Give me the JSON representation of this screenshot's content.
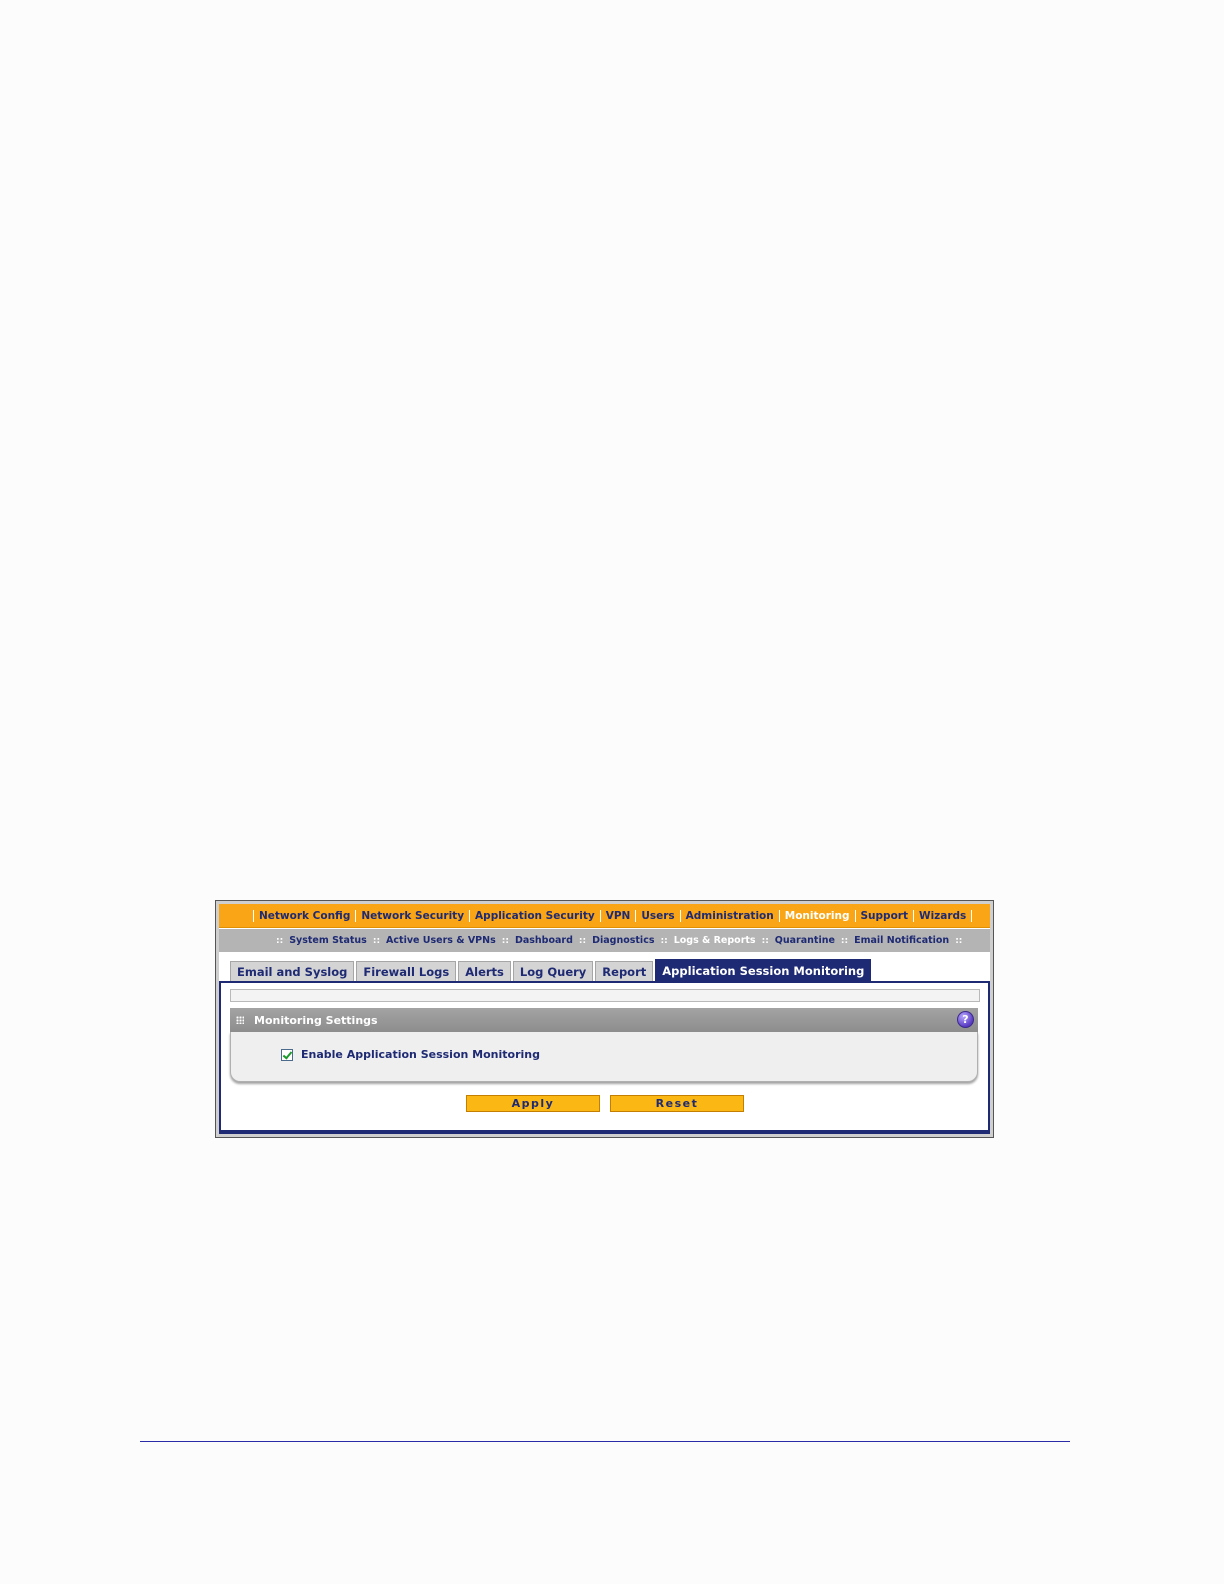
{
  "main_nav": {
    "items": [
      {
        "label": "Network Config",
        "active": false
      },
      {
        "label": "Network Security",
        "active": false
      },
      {
        "label": "Application Security",
        "active": false
      },
      {
        "label": "VPN",
        "active": false
      },
      {
        "label": "Users",
        "active": false
      },
      {
        "label": "Administration",
        "active": false
      },
      {
        "label": "Monitoring",
        "active": true
      },
      {
        "label": "Support",
        "active": false
      },
      {
        "label": "Wizards",
        "active": false
      }
    ]
  },
  "sub_nav": {
    "items": [
      {
        "label": "System Status",
        "active": false
      },
      {
        "label": "Active Users & VPNs",
        "active": false
      },
      {
        "label": "Dashboard",
        "active": false
      },
      {
        "label": "Diagnostics",
        "active": false
      },
      {
        "label": "Logs & Reports",
        "active": true
      },
      {
        "label": "Quarantine",
        "active": false
      },
      {
        "label": "Email Notification",
        "active": false
      }
    ],
    "separator": "::"
  },
  "tabs": [
    {
      "label": "Email and Syslog",
      "active": false
    },
    {
      "label": "Firewall Logs",
      "active": false
    },
    {
      "label": "Alerts",
      "active": false
    },
    {
      "label": "Log Query",
      "active": false
    },
    {
      "label": "Report",
      "active": false
    },
    {
      "label": "Application Session Monitoring",
      "active": true
    }
  ],
  "section": {
    "title": "Monitoring Settings",
    "help_symbol": "?",
    "checkbox_label": "Enable Application Session Monitoring",
    "checkbox_checked": true
  },
  "buttons": {
    "apply_label": "Apply",
    "reset_label": "Reset"
  },
  "colors": {
    "nav_orange": "#f9a516",
    "nav_text": "#1e2a73",
    "subnav_gray": "#b4b4b4",
    "active_tab": "#1e2a73",
    "button_yellow": "#fbb815"
  }
}
